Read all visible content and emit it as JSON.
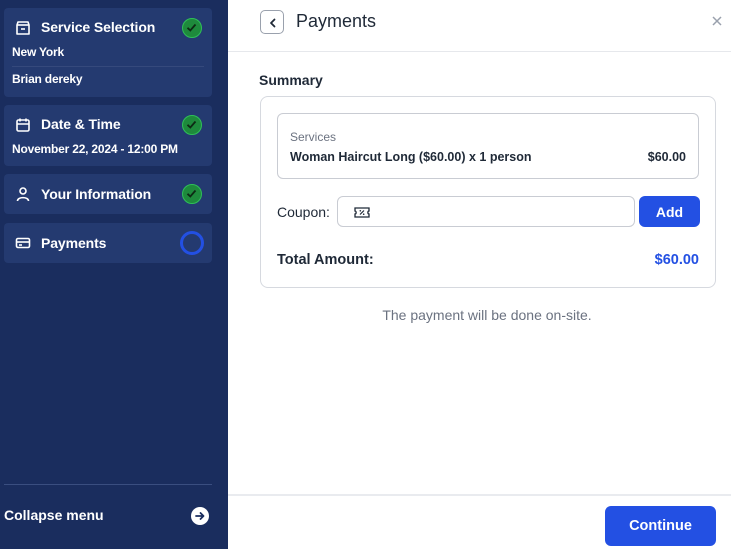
{
  "sidebar": {
    "steps": [
      {
        "title": "Service Selection",
        "details": [
          "New York",
          "Brian dereky"
        ],
        "status": "completed",
        "icon": "store-icon"
      },
      {
        "title": "Date & Time",
        "details": [
          "November 22, 2024 - 12:00 PM"
        ],
        "status": "completed",
        "icon": "calendar-icon"
      },
      {
        "title": "Your Information",
        "details": [],
        "status": "completed",
        "icon": "user-icon"
      },
      {
        "title": "Payments",
        "details": [],
        "status": "current",
        "icon": "credit-card-icon"
      }
    ],
    "collapse_label": "Collapse menu"
  },
  "header": {
    "title": "Payments"
  },
  "summary": {
    "label": "Summary",
    "services_label": "Services",
    "service_name": "Woman Haircut Long ($60.00) x 1 person",
    "service_price": "$60.00",
    "coupon_label": "Coupon:",
    "coupon_value": "",
    "add_label": "Add",
    "total_label": "Total Amount:",
    "total_value": "$60.00"
  },
  "note": "The payment will be done on-site.",
  "footer": {
    "continue_label": "Continue"
  },
  "colors": {
    "sidebar_bg": "#1a2d5e",
    "step_bg": "#243a70",
    "accent": "#2350e3",
    "success": "#1e8a3c"
  }
}
